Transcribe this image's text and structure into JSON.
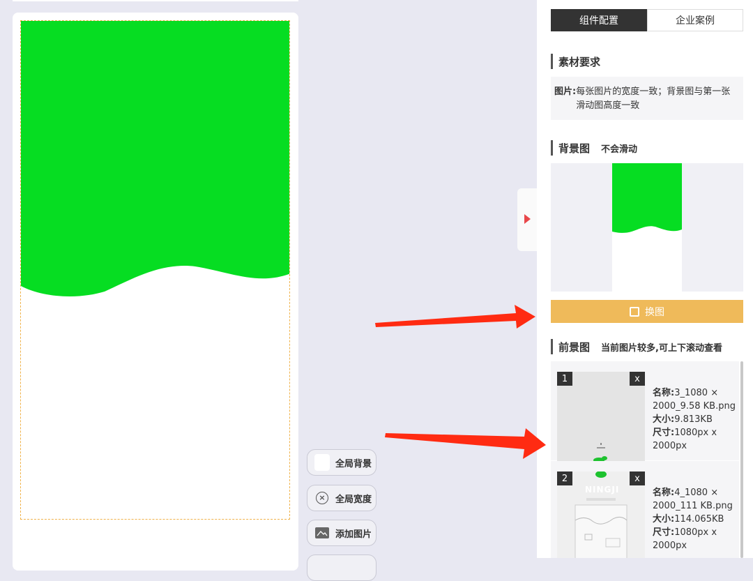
{
  "floating_buttons": {
    "global_bg": "全局背景",
    "global_width": "全局宽度",
    "add_image": "添加图片"
  },
  "panel": {
    "tabs": [
      {
        "label": "组件配置",
        "active": true
      },
      {
        "label": "企业案例",
        "active": false
      }
    ],
    "material": {
      "title": "素材要求",
      "label": "图片:",
      "text": "每张图片的宽度一致；背景图与第一张滑动图高度一致"
    },
    "background": {
      "title": "背景图",
      "subtitle": "不会滑动",
      "swap_label": "换图"
    },
    "foreground": {
      "title": "前景图",
      "subtitle": "当前图片较多,可上下滚动查看",
      "items": [
        {
          "index": "1",
          "delete": "x",
          "name_label": "名称:",
          "name": "3_1080 × 2000_9.58 KB.png",
          "size_label": "大小:",
          "size": "9.813KB",
          "dim_label": "尺寸:",
          "dim": "1080px x 2000px"
        },
        {
          "index": "2",
          "delete": "x",
          "name_label": "名称:",
          "name": "4_1080 × 2000_111 KB.png",
          "size_label": "大小:",
          "size": "114.065KB",
          "dim_label": "尺寸:",
          "dim": "1080px x 2000px",
          "logo_text": "NINGJI"
        }
      ]
    }
  },
  "colors": {
    "green_shape": "#06dd22",
    "swap_button": "#efba5a",
    "arrow": "#ff2b12",
    "collapse_triangle": "#e8474a",
    "active_tab": "#333333"
  }
}
